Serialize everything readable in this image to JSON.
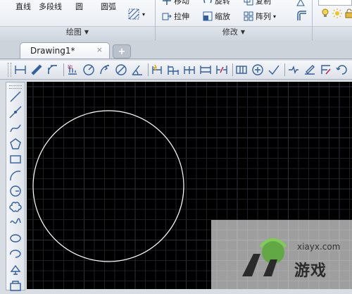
{
  "ribbon": {
    "draw_panel": {
      "title": "绘图",
      "line": "直线",
      "polyline": "多段线",
      "circle": "圆",
      "arc": "圆弧"
    },
    "modify_panel": {
      "title": "修改",
      "move_partial": "移动",
      "rotate_partial": "旋转",
      "copy_partial": "复制",
      "stretch": "拉伸",
      "scale": "缩放",
      "array": "阵列"
    }
  },
  "tabs": {
    "active": "Drawing1*",
    "close_glyph": "×",
    "new_glyph": "+"
  },
  "watermark": {
    "site": "xiayx.com",
    "brand": "游戏"
  },
  "colors": {
    "canvas_bg": "#000000",
    "grid_minor": "#1d2126",
    "grid_major": "#2c323a",
    "circle_stroke": "#ffffff",
    "toolbar_icon": "#2f5f9e",
    "ribbon_bg": "#e9edf2"
  },
  "icons": {
    "dimension_toolbar": [
      "linear-dim-icon",
      "aligned-dim-icon",
      "arc-length-dim-icon",
      "ordinate-dim-icon",
      "radius-dim-icon",
      "jogged-dim-icon",
      "diameter-dim-icon",
      "angular-dim-icon",
      "quick-dim-icon",
      "baseline-dim-icon",
      "continue-dim-icon",
      "dim-space-icon",
      "dim-break-icon",
      "tolerance-icon",
      "center-mark-icon",
      "inspect-icon",
      "jogged-linear-icon",
      "dim-edit-icon",
      "dim-text-edit-icon",
      "dim-update-icon"
    ],
    "draw_toolbar": [
      "line-icon",
      "construction-line-icon",
      "polyline-icon",
      "polygon-icon",
      "rectangle-icon",
      "arc-icon",
      "circle-icon",
      "revision-cloud-icon",
      "spline-icon",
      "ellipse-icon",
      "ellipse-arc-icon",
      "insert-block-icon",
      "make-block-icon"
    ]
  }
}
